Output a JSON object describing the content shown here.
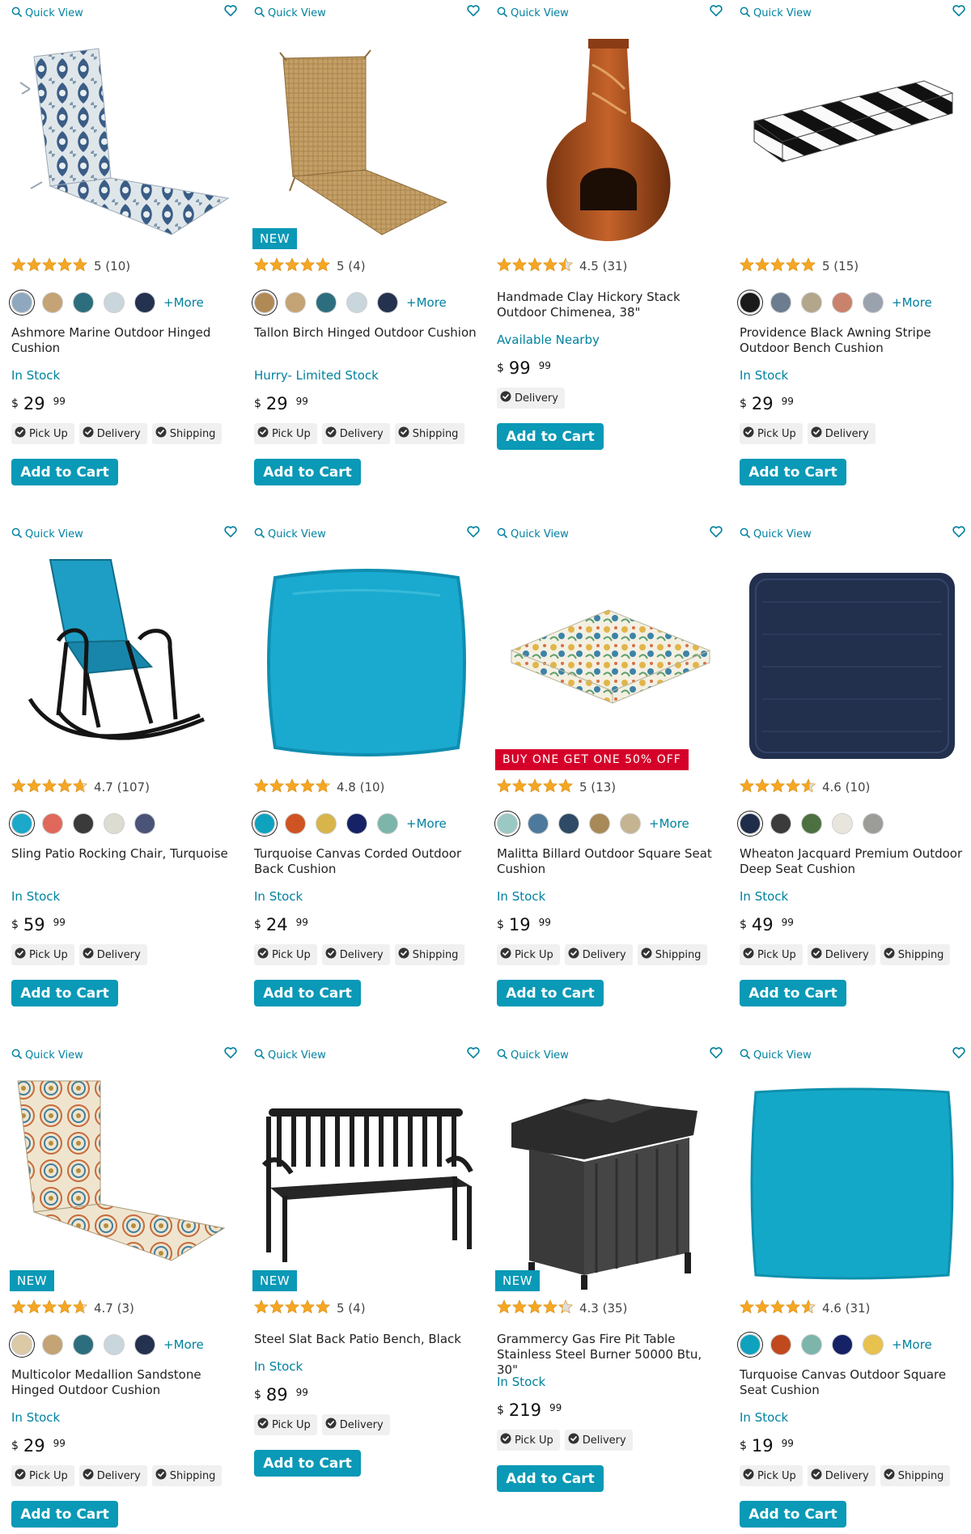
{
  "quick_view_label": "Quick View",
  "more_label": "+More",
  "add_to_cart_label": "Add to Cart",
  "chips": {
    "pickup": "Pick Up",
    "delivery": "Delivery",
    "shipping": "Shipping"
  },
  "colors": {
    "accent": "#0a99b6",
    "link": "#00829f",
    "promo": "#d5002a",
    "star": "#f5a623"
  },
  "products": [
    {
      "title": "Ashmore Marine Outdoor Hinged Cushion",
      "rating": 5,
      "rating_text": "5 (10)",
      "badge": "",
      "image": "ikat-hinged-cushion",
      "swatches": [
        "#8fa8bf",
        "#c4a374",
        "#2d6e7e",
        "#c9d6dc",
        "#24324f"
      ],
      "show_more": true,
      "stock": "In Stock",
      "price_dollars": "29",
      "price_cents": "99",
      "fulfillment": [
        "pickup",
        "delivery",
        "shipping"
      ]
    },
    {
      "title": "Tallon Birch Hinged Outdoor Cushion",
      "rating": 5,
      "rating_text": "5 (4)",
      "badge": "NEW",
      "image": "birch-hinged-cushion",
      "swatches": [
        "#b08a55",
        "#c4a374",
        "#2d6e7e",
        "#c9d6dc",
        "#24324f"
      ],
      "show_more": true,
      "stock": "Hurry- Limited Stock",
      "price_dollars": "29",
      "price_cents": "99",
      "fulfillment": [
        "pickup",
        "delivery",
        "shipping"
      ]
    },
    {
      "title": "Handmade Clay Hickory Stack Outdoor Chimenea, 38\"",
      "rating": 4.5,
      "rating_text": "4.5 (31)",
      "badge": "",
      "image": "clay-chimenea",
      "swatches": [],
      "show_more": false,
      "stock": "Available Nearby",
      "price_dollars": "99",
      "price_cents": "99",
      "fulfillment": [
        "delivery"
      ]
    },
    {
      "title": "Providence Black Awning Stripe Outdoor Bench Cushion",
      "rating": 5,
      "rating_text": "5 (15)",
      "badge": "",
      "image": "stripe-bench-cushion",
      "swatches": [
        "#1a1a1a",
        "#6b7d8f",
        "#b3a68a",
        "#c9826b",
        "#9aa3ad"
      ],
      "show_more": true,
      "stock": "In Stock",
      "price_dollars": "29",
      "price_cents": "99",
      "fulfillment": [
        "pickup",
        "delivery"
      ]
    },
    {
      "title": "Sling Patio Rocking Chair, Turquoise",
      "rating": 4.7,
      "rating_text": "4.7 (107)",
      "badge": "",
      "image": "sling-rocking-chair",
      "swatches": [
        "#1ba8c9",
        "#e0685a",
        "#3a3a3a",
        "#dcdcd0",
        "#4a5478"
      ],
      "show_more": false,
      "stock": "In Stock",
      "price_dollars": "59",
      "price_cents": "99",
      "fulfillment": [
        "pickup",
        "delivery"
      ]
    },
    {
      "title": "Turquoise Canvas Corded Outdoor Back Cushion",
      "rating": 4.8,
      "rating_text": "4.8 (10)",
      "badge": "",
      "image": "turquoise-back-cushion",
      "swatches": [
        "#0ea2bf",
        "#d05423",
        "#d7b54a",
        "#152266",
        "#7db5ab"
      ],
      "show_more": true,
      "stock": "In Stock",
      "price_dollars": "24",
      "price_cents": "99",
      "fulfillment": [
        "pickup",
        "delivery",
        "shipping"
      ]
    },
    {
      "title": "Malitta Billard Outdoor Square Seat Cushion",
      "rating": 5,
      "rating_text": "5 (13)",
      "badge": "BUY ONE GET ONE 50% OFF",
      "image": "floral-seat-cushion",
      "swatches": [
        "#9ac8c2",
        "#4d7a9c",
        "#2e4a66",
        "#a88958",
        "#c4b491"
      ],
      "show_more": true,
      "stock": "In Stock",
      "price_dollars": "19",
      "price_cents": "99",
      "fulfillment": [
        "pickup",
        "delivery",
        "shipping"
      ]
    },
    {
      "title": "Wheaton Jacquard Premium Outdoor Deep Seat Cushion",
      "rating": 4.6,
      "rating_text": "4.6 (10)",
      "badge": "",
      "image": "navy-deep-seat-cushion",
      "swatches": [
        "#1f2d4a",
        "#3b3b3b",
        "#4d7041",
        "#e8e6dc",
        "#9c9c98"
      ],
      "show_more": false,
      "stock": "In Stock",
      "price_dollars": "49",
      "price_cents": "99",
      "fulfillment": [
        "pickup",
        "delivery",
        "shipping"
      ]
    },
    {
      "title": "Multicolor Medallion Sandstone Hinged Outdoor Cushion",
      "rating": 4.7,
      "rating_text": "4.7 (3)",
      "badge": "NEW",
      "image": "medallion-hinged-cushion",
      "swatches": [
        "#dcc9a6",
        "#c4a374",
        "#2d6e7e",
        "#c9d6dc",
        "#24324f"
      ],
      "show_more": true,
      "stock": "In Stock",
      "price_dollars": "29",
      "price_cents": "99",
      "fulfillment": [
        "pickup",
        "delivery",
        "shipping"
      ]
    },
    {
      "title": "Steel Slat Back Patio Bench, Black",
      "rating": 5,
      "rating_text": "5 (4)",
      "badge": "NEW",
      "image": "steel-bench",
      "swatches": [],
      "show_more": false,
      "stock": "In Stock",
      "price_dollars": "89",
      "price_cents": "99",
      "fulfillment": [
        "pickup",
        "delivery"
      ]
    },
    {
      "title": "Grammercy Gas Fire Pit Table Stainless Steel Burner 50000 Btu, 30\"",
      "rating": 4.3,
      "rating_text": "4.3 (35)",
      "badge": "NEW",
      "image": "gas-fire-pit-table",
      "swatches": [],
      "show_more": false,
      "stock": "In Stock",
      "price_dollars": "219",
      "price_cents": "99",
      "fulfillment": [
        "pickup",
        "delivery"
      ]
    },
    {
      "title": "Turquoise Canvas Outdoor Square Seat Cushion",
      "rating": 4.6,
      "rating_text": "4.6 (31)",
      "badge": "",
      "image": "turquoise-seat-cushion",
      "swatches": [
        "#0ea2bf",
        "#c04a1e",
        "#7db5ab",
        "#152266",
        "#e7c24f"
      ],
      "show_more": true,
      "stock": "In Stock",
      "price_dollars": "19",
      "price_cents": "99",
      "fulfillment": [
        "pickup",
        "delivery",
        "shipping"
      ]
    }
  ]
}
